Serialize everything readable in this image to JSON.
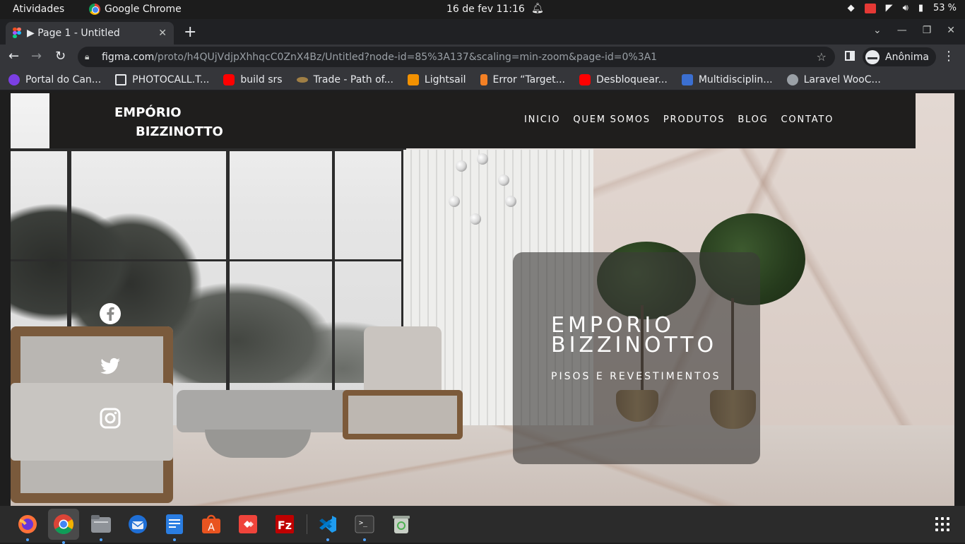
{
  "system_bar": {
    "activities": "Atividades",
    "app_name": "Google Chrome",
    "clock": "16 de fev  11:16",
    "battery": "53 %"
  },
  "browser": {
    "tab_title": "▶ Page 1 - Untitled",
    "url_host": "figma.com",
    "url_path": "/proto/h4QUjVdjpXhhqcC0ZnX4Bz/Untitled?node-id=85%3A137&scaling=min-zoom&page-id=0%3A1",
    "profile_label": "Anônima",
    "bookmarks": [
      {
        "label": "Portal do Can...",
        "color": "#7b3fe4"
      },
      {
        "label": "PHOTOCALL.T...",
        "color": "#1a1a1a"
      },
      {
        "label": "build srs",
        "color": "#ff0000"
      },
      {
        "label": "Trade - Path of...",
        "color": "#a07f45"
      },
      {
        "label": "Lightsail",
        "color": "#f29100"
      },
      {
        "label": "Error “Target...",
        "color": "#f48024"
      },
      {
        "label": "Desbloquear...",
        "color": "#ff0000"
      },
      {
        "label": "Multidisciplin...",
        "color": "#3b6fd1"
      },
      {
        "label": "Laravel WooC...",
        "color": "#9aa0a6"
      }
    ]
  },
  "site": {
    "logo_line1": "EMPÓRIO",
    "logo_line2": "BIZZINOTTO",
    "menu": [
      "INICIO",
      "QUEM SOMOS",
      "PRODUTOS",
      "BLOG",
      "CONTATO"
    ],
    "social_icons": [
      "facebook-icon",
      "twitter-icon",
      "instagram-icon"
    ],
    "hero_title_line1": "EMPORIO",
    "hero_title_line2": "BIZZINOTTO",
    "hero_subtitle": "PISOS E REVESTIMENTOS"
  },
  "dock": {
    "apps": [
      "firefox-icon",
      "chrome-icon",
      "files-icon",
      "thunderbird-icon",
      "text-editor-icon",
      "software-center-icon",
      "anydesk-icon",
      "filezilla-icon",
      "vscode-icon",
      "terminal-icon",
      "trash-icon"
    ]
  }
}
